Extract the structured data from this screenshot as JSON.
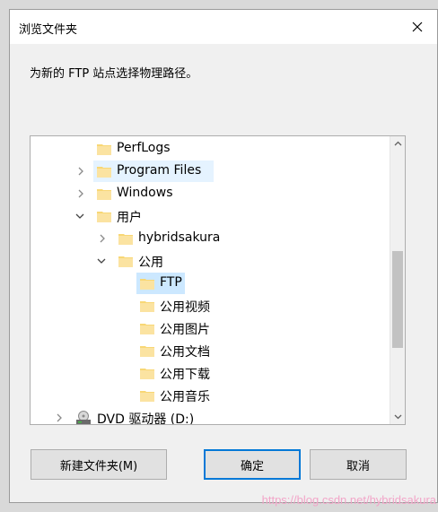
{
  "window": {
    "title": "浏览文件夹"
  },
  "prompt": "为新的 FTP 站点选择物理路径。",
  "tree": {
    "nodes": [
      {
        "label": "PerfLogs",
        "expander": "none"
      },
      {
        "label": "Program Files",
        "expander": "collapsed"
      },
      {
        "label": "Windows",
        "expander": "collapsed"
      },
      {
        "label": "用户",
        "expander": "expanded"
      },
      {
        "label": "hybridsakura",
        "expander": "collapsed"
      },
      {
        "label": "公用",
        "expander": "expanded"
      },
      {
        "label": "FTP",
        "expander": "none"
      },
      {
        "label": "公用视频",
        "expander": "none"
      },
      {
        "label": "公用图片",
        "expander": "none"
      },
      {
        "label": "公用文档",
        "expander": "none"
      },
      {
        "label": "公用下载",
        "expander": "none"
      },
      {
        "label": "公用音乐",
        "expander": "none"
      },
      {
        "label": "DVD 驱动器 (D:)",
        "expander": "collapsed",
        "icon": "dvd-drive-icon"
      }
    ]
  },
  "buttons": {
    "new_folder": "新建文件夹(M)",
    "ok": "确定",
    "cancel": "取消"
  },
  "watermark": "https://blog.csdn.net/hybridsakura",
  "colors": {
    "folder": "#f8d775",
    "selection": "#cce8ff",
    "hover": "#e5f3ff",
    "accent": "#0078d7",
    "watermark": "#f2a5c8"
  }
}
